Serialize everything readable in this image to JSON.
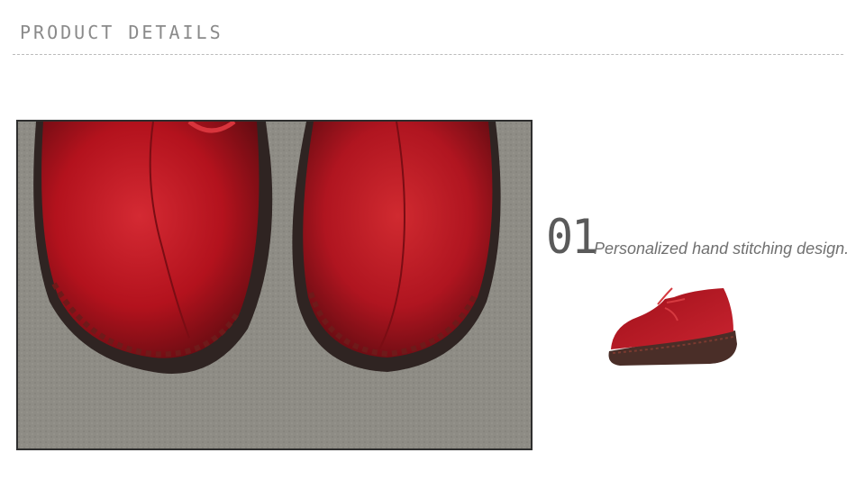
{
  "header": {
    "title": "PRODUCT DETAILS"
  },
  "feature": {
    "number": "01",
    "description": "Personalized hand stitching design."
  },
  "colors": {
    "leather": "#b3121d",
    "leather_dark": "#5a0b10",
    "sole": "#3a2a26",
    "background_felt": "#8f8d86",
    "text_gray": "#707070"
  },
  "images": {
    "main": "close-up-shoe-toes",
    "thumbnail": "red-leather-lace-up-shoe"
  }
}
